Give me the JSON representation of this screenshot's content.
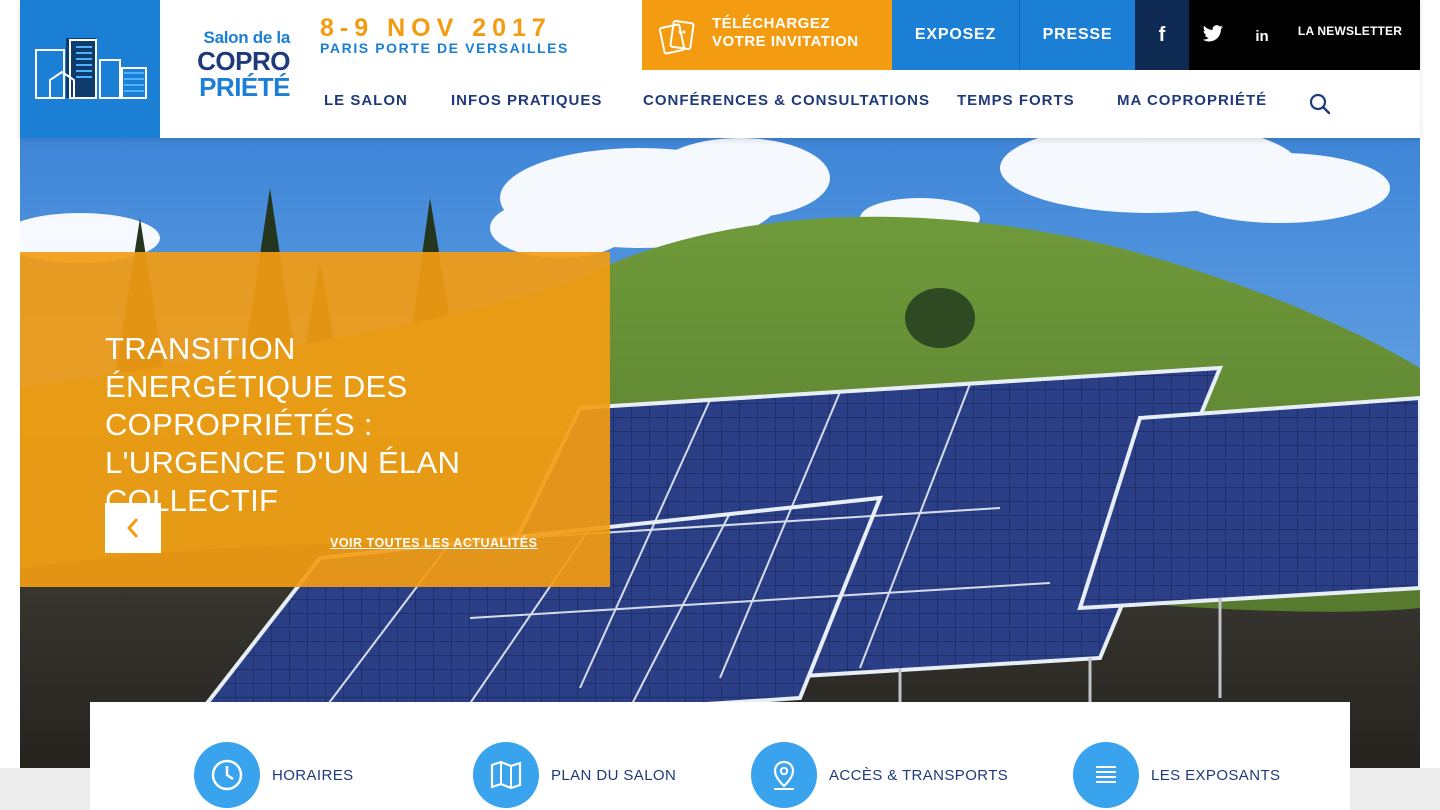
{
  "logo": {
    "line1": "Salon de la",
    "line2": "COPRO",
    "line3": "PRIÉTÉ"
  },
  "event": {
    "dates": "8-9 NOV 2017",
    "place": "PARIS PORTE DE VERSAILLES"
  },
  "topbar": {
    "invite_line1": "TÉLÉCHARGEZ",
    "invite_line2": "VOTRE INVITATION",
    "exposez": "EXPOSEZ",
    "presse": "PRESSE",
    "facebook": "f",
    "linkedin": "in",
    "newsletter": "LA NEWSLETTER"
  },
  "nav": {
    "items": [
      "LE SALON",
      "INFOS PRATIQUES",
      "CONFÉRENCES & CONSULTATIONS",
      "TEMPS FORTS",
      "MA COPROPRIÉTÉ"
    ]
  },
  "hero": {
    "title": "TRANSITION ÉNERGÉTIQUE DES COPROPRIÉTÉS : L'URGENCE D'UN ÉLAN COLLECTIF",
    "all_news": "VOIR TOUTES LES ACTUALITÉS"
  },
  "quick_links": [
    {
      "label": "HORAIRES",
      "icon": "clock-icon"
    },
    {
      "label": "PLAN DU SALON",
      "icon": "map-icon"
    },
    {
      "label": "ACCÈS & TRANSPORTS",
      "icon": "location-pin-icon"
    },
    {
      "label": "LES EXPOSANTS",
      "icon": "list-icon"
    }
  ],
  "colors": {
    "blue": "#1c7fd6",
    "navy": "#1f3a7a",
    "orange": "#f39c12",
    "light_blue": "#3aa3ee"
  }
}
